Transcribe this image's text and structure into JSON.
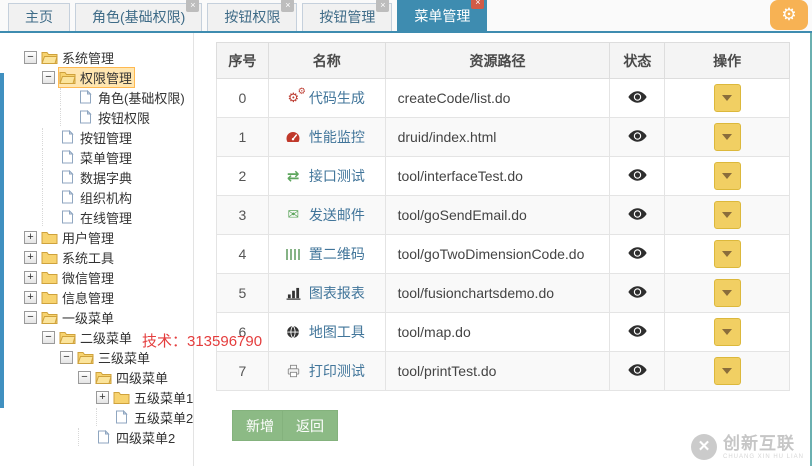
{
  "icons": {
    "close": "×",
    "gear": "⚙",
    "exchange": "⇄",
    "envelope": "✉"
  },
  "tabs": [
    {
      "label": "主页",
      "closable": false,
      "active": false
    },
    {
      "label": "角色(基础权限)",
      "closable": true,
      "active": false
    },
    {
      "label": "按钮权限",
      "closable": true,
      "active": false
    },
    {
      "label": "按钮管理",
      "closable": true,
      "active": false
    },
    {
      "label": "菜单管理",
      "closable": true,
      "active": true
    }
  ],
  "tree": {
    "items": [
      {
        "label": "系统管理",
        "level": 0,
        "icon": "folder-open-icon",
        "expander": "minus",
        "selected": false
      },
      {
        "label": "权限管理",
        "level": 1,
        "icon": "folder-open-icon",
        "expander": "minus",
        "selected": true
      },
      {
        "label": "角色(基础权限)",
        "level": 2,
        "icon": "file-icon",
        "expander": "none",
        "selected": false
      },
      {
        "label": "按钮权限",
        "level": 2,
        "icon": "file-icon",
        "expander": "none",
        "selected": false
      },
      {
        "label": "按钮管理",
        "level": 1,
        "icon": "file-icon",
        "expander": "none",
        "selected": false
      },
      {
        "label": "菜单管理",
        "level": 1,
        "icon": "file-icon",
        "expander": "none",
        "selected": false
      },
      {
        "label": "数据字典",
        "level": 1,
        "icon": "file-icon",
        "expander": "none",
        "selected": false
      },
      {
        "label": "组织机构",
        "level": 1,
        "icon": "file-icon",
        "expander": "none",
        "selected": false
      },
      {
        "label": "在线管理",
        "level": 1,
        "icon": "file-icon",
        "expander": "none",
        "selected": false
      },
      {
        "label": "用户管理",
        "level": 0,
        "icon": "folder-closed-icon",
        "expander": "plus",
        "selected": false
      },
      {
        "label": "系统工具",
        "level": 0,
        "icon": "folder-closed-icon",
        "expander": "plus",
        "selected": false
      },
      {
        "label": "微信管理",
        "level": 0,
        "icon": "folder-closed-icon",
        "expander": "plus",
        "selected": false
      },
      {
        "label": "信息管理",
        "level": 0,
        "icon": "folder-closed-icon",
        "expander": "plus",
        "selected": false
      },
      {
        "label": "一级菜单",
        "level": 0,
        "icon": "folder-open-icon",
        "expander": "minus",
        "selected": false
      },
      {
        "label": "二级菜单",
        "level": 1,
        "icon": "folder-open-icon",
        "expander": "minus",
        "selected": false
      },
      {
        "label": "三级菜单",
        "level": 2,
        "icon": "folder-open-icon",
        "expander": "minus",
        "selected": false
      },
      {
        "label": "四级菜单",
        "level": 3,
        "icon": "folder-open-icon",
        "expander": "minus",
        "selected": false
      },
      {
        "label": "五级菜单1",
        "level": 4,
        "icon": "folder-closed-icon",
        "expander": "plus",
        "selected": false
      },
      {
        "label": "五级菜单2",
        "level": 4,
        "icon": "file-icon",
        "expander": "none",
        "selected": false
      },
      {
        "label": "四级菜单2",
        "level": 3,
        "icon": "file-icon",
        "expander": "none",
        "selected": false
      }
    ]
  },
  "overlay_text": "技术：313596790",
  "table": {
    "columns": [
      "序号",
      "名称",
      "资源路径",
      "状态",
      "操作"
    ],
    "rows": [
      {
        "index": "0",
        "name": "代码生成",
        "icon": "cogs-icon",
        "path": "createCode/list.do"
      },
      {
        "index": "1",
        "name": "性能监控",
        "icon": "tachometer-icon",
        "path": "druid/index.html"
      },
      {
        "index": "2",
        "name": "接口测试",
        "icon": "exchange-icon",
        "path": "tool/interfaceTest.do"
      },
      {
        "index": "3",
        "name": "发送邮件",
        "icon": "envelope-icon",
        "path": "tool/goSendEmail.do"
      },
      {
        "index": "4",
        "name": "置二维码",
        "icon": "barcode-icon",
        "path": "tool/goTwoDimensionCode.do"
      },
      {
        "index": "5",
        "name": "图表报表",
        "icon": "bar-chart-icon",
        "path": "tool/fusionchartsdemo.do"
      },
      {
        "index": "6",
        "name": "地图工具",
        "icon": "globe-icon",
        "path": "tool/map.do"
      },
      {
        "index": "7",
        "name": "打印测试",
        "icon": "printer-icon",
        "path": "tool/printTest.do"
      }
    ],
    "status_icon": "eye-icon"
  },
  "buttons": {
    "add": "新增",
    "back": "返回"
  },
  "watermark": {
    "text": "创新互联",
    "subtext": "CHUANG XIN HU LIAN",
    "glyph": "✕"
  },
  "colors": {
    "active_tab": "#3e8cb0",
    "accent_orange": "#f7b254",
    "button_green": "#8cba85",
    "dropdown_yellow": "#f1cf63",
    "close_red": "#d15b47",
    "tech_red": "#e43d3d",
    "selected_node_bg": "#ffe6b0"
  }
}
